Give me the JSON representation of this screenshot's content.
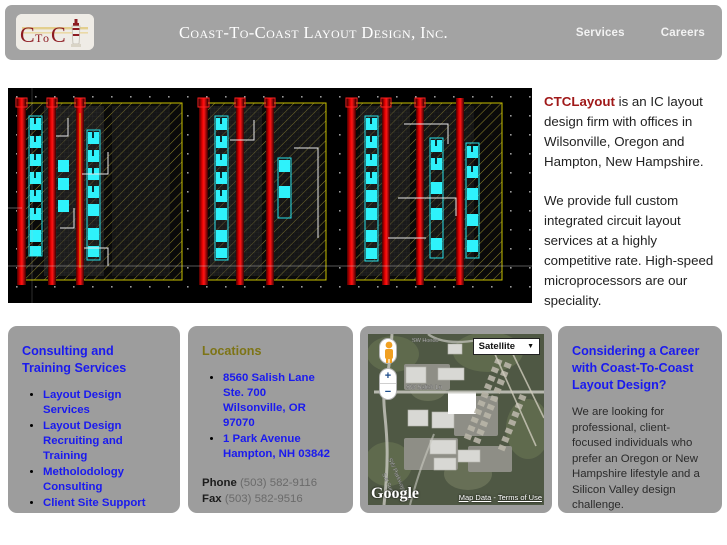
{
  "header": {
    "logo_alt": "CToC",
    "logo_text": "CToC",
    "site_title": "Coast-To-Coast Layout Design, Inc.",
    "nav": [
      {
        "label": "Services"
      },
      {
        "label": "Careers"
      }
    ]
  },
  "hero": {
    "alt": "IC layout screenshot"
  },
  "intro": {
    "brand": "CTCLayout",
    "paragraph1_rest": " is an IC layout design firm with offices in Wilsonville, Oregon and Hampton, New Hampshire.",
    "paragraph2": "We provide full custom integrated circuit layout services at a highly competitive rate. High-speed microprocessors are our speciality."
  },
  "panels": {
    "services": {
      "title": "Consulting and Training Services",
      "items": [
        "Layout Design Services",
        "Layout Design Recruiting and Training",
        "Metholodology Consulting",
        "Client Site Support"
      ]
    },
    "locations": {
      "title": "Locations",
      "addresses": [
        [
          "8560 Salish Lane",
          "Ste. 700",
          "Wilsonville, OR 97070"
        ],
        [
          "1 Park Avenue",
          "Hampton, NH 03842"
        ]
      ],
      "phone_label": "Phone",
      "phone_value": "(503) 582-9116",
      "fax_label": "Fax",
      "fax_value": "(503) 582-9516"
    },
    "map": {
      "map_type": "Satellite",
      "caret": "▼",
      "zoom_in": "+",
      "zoom_out": "−",
      "provider": "Google",
      "map_data_label": "Map Data",
      "separator": " - ",
      "terms_label": "Terms of Use",
      "street_label_1": "SW Salish Ln",
      "street_label_2": "SW Parkway Ave",
      "street_label_3": "SW Sun Pl",
      "street_label_4": "SW Hondo"
    },
    "careers": {
      "title": "Considering a Career with Coast-To-Coast Layout Design?",
      "body": "We are looking for professional, client-focused individuals who prefer an Oregon or New Hampshire lifestyle and a Silicon Valley design challenge."
    }
  },
  "colors": {
    "header_bg": "#a3a3a3",
    "panel_bg": "#9d9d9d",
    "link_blue": "#1a1aef",
    "brand_red": "#a01919",
    "olive": "#7d7416",
    "page_bg": "#ffffff"
  }
}
